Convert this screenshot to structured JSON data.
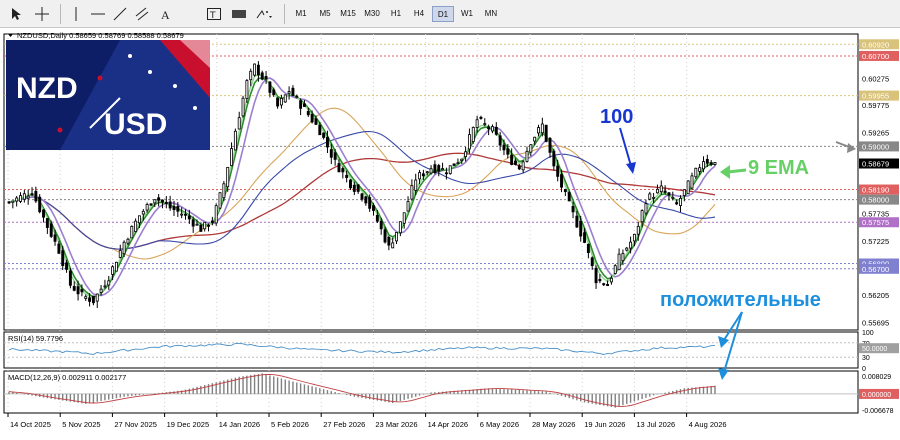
{
  "toolbar": {
    "icons": [
      "cursor-icon",
      "crosshair-icon",
      "hline-icon",
      "trendline-icon",
      "channel-icon",
      "text-icon",
      "label-icon",
      "shapes-icon"
    ],
    "timeframes": [
      "M1",
      "M5",
      "M15",
      "M30",
      "H1",
      "H4",
      "D1",
      "W1",
      "MN"
    ],
    "active_timeframe": "D1"
  },
  "symbol_info": "NZDUSD,Daily  0.58659 0.58769 0.58588 0.58679",
  "logo": {
    "top": "NZD",
    "bottom": "USD"
  },
  "annotations": {
    "ma100_label": "100",
    "ema9_label": "9 EMA",
    "positive_label": "положительные"
  },
  "colors": {
    "background": "#ffffff",
    "candle": "#000000",
    "ema9": "#90d890",
    "sma_green": "#2e8b2e",
    "sma_purple": "#9b7fd0",
    "ma100": "#3a4aa8",
    "ma_tan": "#d9a55a",
    "ma_red": "#b03a3a",
    "annotation_blue": "#1a36d0",
    "annotation_green": "#66d066",
    "annotation_cyan": "#1e8fdc",
    "rsi_line": "#4a90c8",
    "macd_signal": "#c04040"
  },
  "chart_data": [
    {
      "type": "candlestick",
      "symbol": "NZDUSD",
      "timeframe": "Daily",
      "ohlc_last": {
        "open": 0.58659,
        "high": 0.58769,
        "low": 0.58588,
        "close": 0.58679
      },
      "x_labels": [
        "14 Oct 2025",
        "5 Nov 2025",
        "27 Nov 2025",
        "19 Dec 2025",
        "14 Jan 2026",
        "5 Feb 2026",
        "27 Feb 2026",
        "23 Mar 2026",
        "14 Apr 2026",
        "6 May 2026",
        "28 May 2026",
        "19 Jun 2026",
        "13 Jul 2026",
        "4 Aug 2026"
      ],
      "y_ticks": [
        "0.60920",
        "0.60700",
        "0.60275",
        "0.59955",
        "0.59775",
        "0.59265",
        "0.59000",
        "0.58679",
        "0.58190",
        "0.58000",
        "0.57735",
        "0.57575",
        "0.57225",
        "0.56800",
        "0.56700",
        "0.56205",
        "0.55695"
      ],
      "price_levels": [
        {
          "label": "0.60920",
          "value": 0.6092,
          "color": "#d9c27a"
        },
        {
          "label": "0.60700",
          "value": 0.607,
          "color": "#e06060"
        },
        {
          "label": "0.59955",
          "value": 0.59955,
          "color": "#d9c27a"
        },
        {
          "label": "0.59000",
          "value": 0.59,
          "color": "#888888"
        },
        {
          "label": "0.58190",
          "value": 0.5819,
          "color": "#e06060"
        },
        {
          "label": "0.58000",
          "value": 0.58,
          "color": "#888888"
        },
        {
          "label": "0.57575",
          "value": 0.57575,
          "color": "#b070c8"
        },
        {
          "label": "0.56800",
          "value": 0.568,
          "color": "#8080d0"
        },
        {
          "label": "0.56700",
          "value": 0.567,
          "color": "#8080d0"
        }
      ],
      "current_price": 0.58679,
      "ylim": [
        0.5555,
        0.61
      ],
      "anchors": [
        [
          0,
          0.5795
        ],
        [
          6,
          0.5815
        ],
        [
          10,
          0.575
        ],
        [
          13,
          0.5705
        ],
        [
          16,
          0.564
        ],
        [
          19,
          0.562
        ],
        [
          22,
          0.561
        ],
        [
          26,
          0.5655
        ],
        [
          30,
          0.572
        ],
        [
          34,
          0.577
        ],
        [
          38,
          0.5805
        ],
        [
          42,
          0.5785
        ],
        [
          46,
          0.577
        ],
        [
          50,
          0.5745
        ],
        [
          53,
          0.576
        ],
        [
          56,
          0.583
        ],
        [
          59,
          0.593
        ],
        [
          62,
          0.602
        ],
        [
          64,
          0.605
        ],
        [
          67,
          0.602
        ],
        [
          70,
          0.5975
        ],
        [
          73,
          0.6005
        ],
        [
          77,
          0.597
        ],
        [
          81,
          0.593
        ],
        [
          85,
          0.587
        ],
        [
          89,
          0.583
        ],
        [
          93,
          0.58
        ],
        [
          96,
          0.576
        ],
        [
          99,
          0.571
        ],
        [
          102,
          0.5755
        ],
        [
          106,
          0.584
        ],
        [
          110,
          0.586
        ],
        [
          114,
          0.5855
        ],
        [
          118,
          0.588
        ],
        [
          122,
          0.595
        ],
        [
          126,
          0.593
        ],
        [
          130,
          0.588
        ],
        [
          133,
          0.586
        ],
        [
          136,
          0.591
        ],
        [
          139,
          0.594
        ],
        [
          142,
          0.586
        ],
        [
          146,
          0.579
        ],
        [
          150,
          0.572
        ],
        [
          153,
          0.565
        ],
        [
          156,
          0.564
        ],
        [
          159,
          0.569
        ],
        [
          163,
          0.573
        ],
        [
          166,
          0.58
        ],
        [
          170,
          0.582
        ],
        [
          174,
          0.579
        ],
        [
          178,
          0.584
        ],
        [
          181,
          0.5875
        ],
        [
          184,
          0.5868
        ]
      ],
      "ema_offset": 0,
      "indicators": [
        "EMA 9",
        "MA 100"
      ]
    },
    {
      "type": "line",
      "indicator": "RSI(14)",
      "label": "RSI(14) 59.7796",
      "value": 59.7796,
      "y_ticks": [
        "100",
        "70",
        "50.0000",
        "30",
        "0"
      ],
      "ylim": [
        0,
        100
      ],
      "anchors": [
        [
          0,
          52
        ],
        [
          15,
          45
        ],
        [
          22,
          40
        ],
        [
          40,
          60
        ],
        [
          60,
          66
        ],
        [
          80,
          50
        ],
        [
          100,
          44
        ],
        [
          120,
          56
        ],
        [
          140,
          54
        ],
        [
          155,
          40
        ],
        [
          170,
          56
        ],
        [
          184,
          59.8
        ]
      ]
    },
    {
      "type": "bar",
      "indicator": "MACD(12,26,9)",
      "label": "MACD(12,26,9) 0.002911 0.002177",
      "values": {
        "macd": 0.002911,
        "signal": 0.002177
      },
      "y_ticks": [
        "0.008029",
        "0.000000",
        "-0.006678"
      ],
      "ylim": [
        -0.006678,
        0.008029
      ],
      "anchors": [
        [
          0,
          0.0008
        ],
        [
          10,
          -0.0015
        ],
        [
          20,
          -0.0035
        ],
        [
          30,
          -0.001
        ],
        [
          45,
          0.0012
        ],
        [
          60,
          0.006
        ],
        [
          66,
          0.0072
        ],
        [
          75,
          0.004
        ],
        [
          90,
          -0.001
        ],
        [
          100,
          -0.0032
        ],
        [
          110,
          0.0005
        ],
        [
          125,
          0.002
        ],
        [
          140,
          0.0008
        ],
        [
          150,
          -0.003
        ],
        [
          158,
          -0.0048
        ],
        [
          168,
          -0.0005
        ],
        [
          176,
          0.002
        ],
        [
          184,
          0.0029
        ]
      ]
    }
  ]
}
